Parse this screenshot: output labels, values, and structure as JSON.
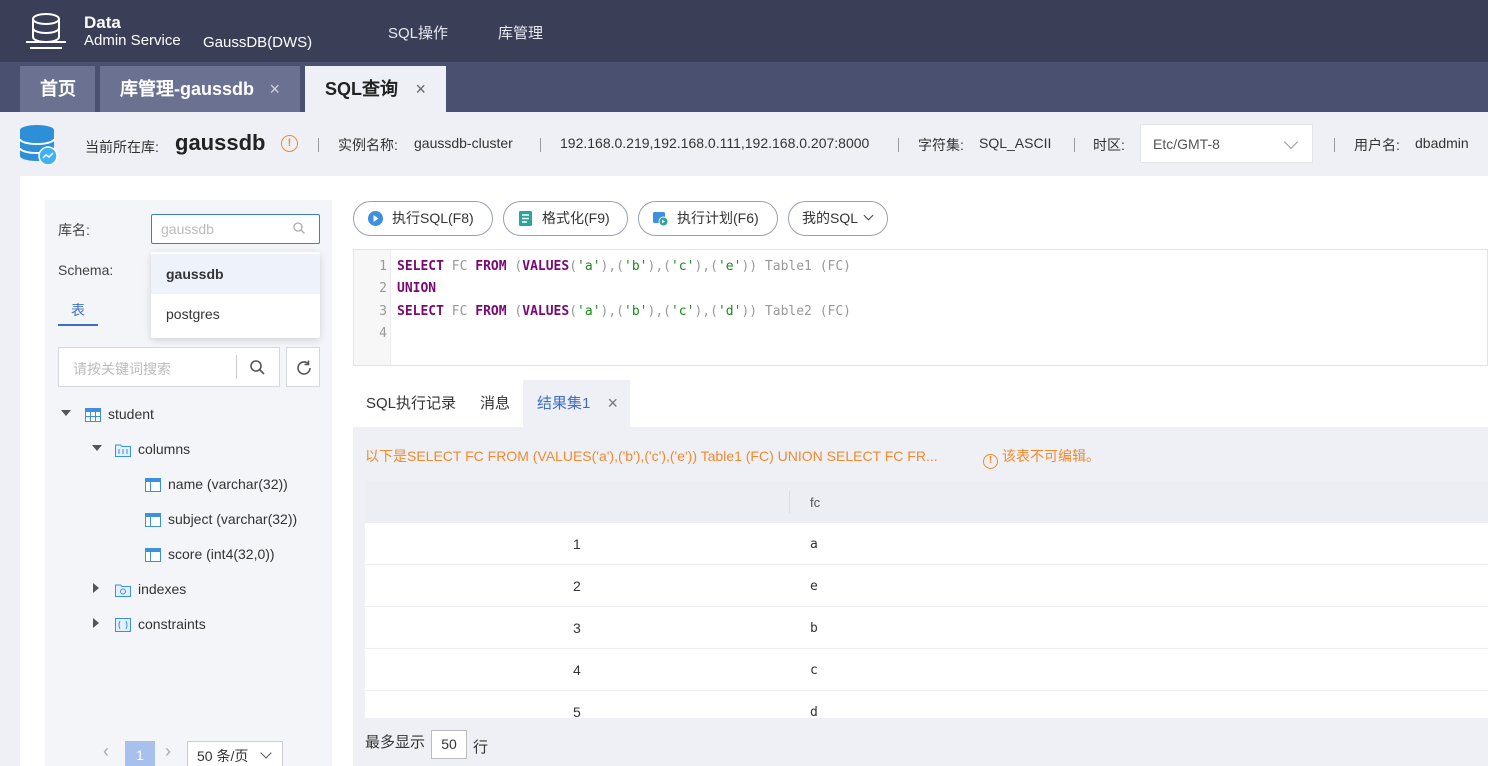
{
  "header": {
    "logo_line1": "Data",
    "logo_line2": "Admin Service",
    "product": "GaussDB(DWS)",
    "nav": [
      "SQL操作",
      "库管理"
    ]
  },
  "tabs": [
    {
      "label": "首页",
      "closable": false
    },
    {
      "label": "库管理-gaussdb",
      "closable": true
    },
    {
      "label": "SQL查询",
      "closable": true,
      "active": true
    }
  ],
  "infobar": {
    "current_db_label": "当前所在库:",
    "current_db": "gaussdb",
    "instance_label": "实例名称:",
    "instance": "gaussdb-cluster",
    "hosts": "192.168.0.219,192.168.0.111,192.168.0.207:8000",
    "charset_label": "字符集:",
    "charset": "SQL_ASCII",
    "timezone_label": "时区:",
    "timezone": "Etc/GMT-8",
    "user_label": "用户名:",
    "user": "dbadmin"
  },
  "left": {
    "db_label": "库名:",
    "db_placeholder": "gaussdb",
    "schema_label": "Schema:",
    "db_options": [
      "gaussdb",
      "postgres"
    ],
    "selected_option": "gaussdb",
    "table_tab": "表",
    "search_placeholder": "请按关键词搜索",
    "tree": {
      "table": "student",
      "columns_folder": "columns",
      "columns": [
        "name (varchar(32))",
        "subject (varchar(32))",
        "score (int4(32,0))"
      ],
      "indexes": "indexes",
      "constraints": "constraints"
    },
    "pager": {
      "page": "1",
      "page_size": "50 条/页"
    }
  },
  "toolbar": {
    "run": "执行SQL(F8)",
    "format": "格式化(F9)",
    "plan": "执行计划(F6)",
    "mysql": "我的SQL"
  },
  "editor": {
    "line_numbers": [
      "1",
      "2",
      "3",
      "4"
    ]
  },
  "result_tabs": [
    "SQL执行记录",
    "消息",
    "结果集1"
  ],
  "result": {
    "message": "以下是SELECT FC FROM (VALUES('a'),('b'),('c'),('e')) Table1 (FC) UNION SELECT FC FR...",
    "readonly_note": "该表不可编辑。",
    "column": "fc",
    "rows": [
      {
        "n": "1",
        "fc": "a"
      },
      {
        "n": "2",
        "fc": "e"
      },
      {
        "n": "3",
        "fc": "b"
      },
      {
        "n": "4",
        "fc": "c"
      },
      {
        "n": "5",
        "fc": "d"
      }
    ],
    "max_label": "最多显示",
    "max_value": "50",
    "row_unit": "行"
  },
  "colors": {
    "accent": "#3e6fc4",
    "warning": "#f08a2b",
    "header_bg": "#3a3f57"
  }
}
